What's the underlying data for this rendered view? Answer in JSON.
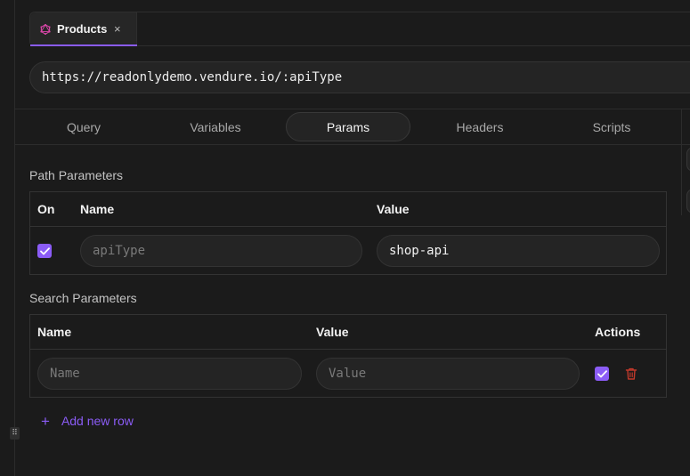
{
  "tabs": [
    {
      "label": "Products",
      "icon": "graphql-icon",
      "close_glyph": "×",
      "active": true
    }
  ],
  "url": {
    "value": "https://readonlydemo.vendure.io/:apiType"
  },
  "request_tabs": [
    {
      "label": "Query",
      "active": false
    },
    {
      "label": "Variables",
      "active": false
    },
    {
      "label": "Params",
      "active": true
    },
    {
      "label": "Headers",
      "active": false
    },
    {
      "label": "Scripts",
      "active": false
    }
  ],
  "path_parameters": {
    "title": "Path Parameters",
    "headers": {
      "on": "On",
      "name": "Name",
      "value": "Value"
    },
    "rows": [
      {
        "enabled": true,
        "name": "apiType",
        "value": "shop-api"
      }
    ]
  },
  "search_parameters": {
    "title": "Search Parameters",
    "headers": {
      "name": "Name",
      "value": "Value",
      "actions": "Actions"
    },
    "new_row": {
      "name_placeholder": "Name",
      "value_placeholder": "Value",
      "enabled": true
    }
  },
  "add_row": {
    "plus_glyph": "+",
    "label": "Add new row"
  },
  "resize_glyph": "⠿",
  "colors": {
    "accent": "#8b5cf6",
    "danger": "#c0392b",
    "background": "#1b1b1b",
    "input_bg": "#242424",
    "border": "#333333"
  }
}
